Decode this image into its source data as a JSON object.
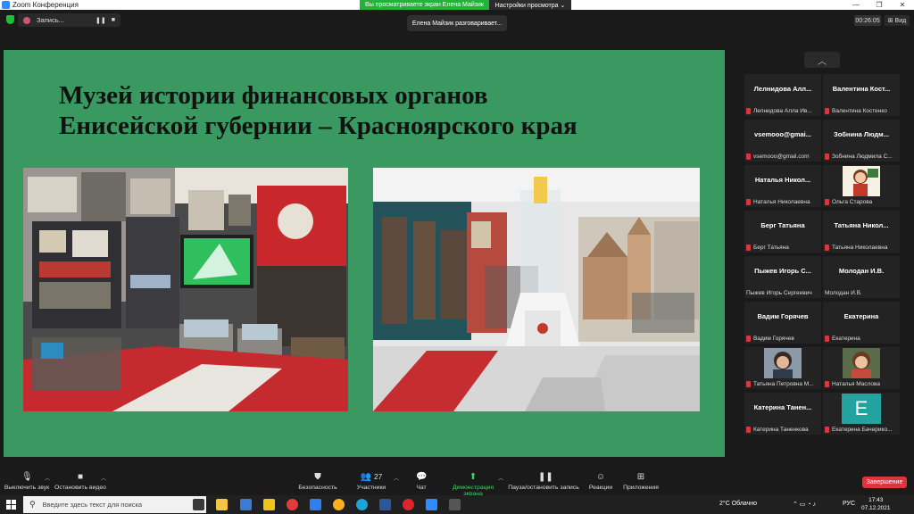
{
  "window": {
    "title": "Zoom Конференция",
    "min": "—",
    "max": "❐",
    "close": "✕"
  },
  "topbar": {
    "recording_label": "Запись...",
    "recording_ctrl": [
      "❚❚",
      "■"
    ],
    "share_banner": "Вы просматриваете экран Елена Майзик",
    "view_options": "Настройки просмотра ⌄",
    "talking_tooltip": "Елена Майзик разговаривает...",
    "timer": "00:26:05",
    "view_button": "⊞ Вид"
  },
  "slide": {
    "title_line1": "Музей истории финансовых органов",
    "title_line2": "Енисейской губернии – Красноярского края"
  },
  "panel": {
    "scroll_up": "︿",
    "participants": [
      {
        "name": "Лелнидова  Алл...",
        "footer": "Лелнидова Алла Ив...",
        "avatar": ""
      },
      {
        "name": "Валентина  Кост...",
        "footer": "Валентина Костенко",
        "avatar": ""
      },
      {
        "name": "vsemooo@gmai...",
        "footer": "vsemooo@gmail.com",
        "avatar": ""
      },
      {
        "name": "Зобнина  Людм...",
        "footer": "Зобнина Людмила С...",
        "avatar": ""
      },
      {
        "name": "Наталья  Никол...",
        "footer": "Наталья Николаевна",
        "avatar": ""
      },
      {
        "name": "",
        "footer": "Ольга Старова",
        "avatar": "teacher-cartoon"
      },
      {
        "name": "Берг Татьяна",
        "footer": "Берг Татьяна",
        "avatar": ""
      },
      {
        "name": "Татьяна  Никол...",
        "footer": "Татьяна Николаевна",
        "avatar": ""
      },
      {
        "name": "Пыжев  Игорь  С...",
        "footer": "Пыжев Игорь Сергеевич",
        "avatar": ""
      },
      {
        "name": "Молодан И.В.",
        "footer": "Молодан И.В.",
        "avatar": ""
      },
      {
        "name": "Вадим Горячев",
        "footer": "Вадим Горячев",
        "avatar": ""
      },
      {
        "name": "Екатерина",
        "footer": "Екатерина",
        "avatar": ""
      },
      {
        "name": "",
        "footer": "Татьяна Петровна М...",
        "avatar": "photo"
      },
      {
        "name": "",
        "footer": "Наталья Маслова",
        "avatar": "photo"
      },
      {
        "name": "Катерина  Танен...",
        "footer": "Катерина Таненкова",
        "avatar": ""
      },
      {
        "name": "",
        "footer": "Екатерина Бачерико...",
        "avatar": "letter",
        "letter": "E"
      }
    ]
  },
  "toolbar": {
    "mute": "Выключить звук",
    "stop_video": "Остановить видео",
    "security": "Безопасность",
    "participants": "Участники",
    "participants_count": "27",
    "chat": "Чат",
    "share": "Демонстрация экрана",
    "pause_rec": "Пауза/остановить запись",
    "reactions": "Реакции",
    "apps": "Приложения",
    "end": "Завершение",
    "caret": "︿"
  },
  "taskbar": {
    "search_placeholder": "Введите здесь текст для поиска",
    "search_glyph": "⚲",
    "weather": "2°C  Облачно",
    "tray_icons": "⌃  ▭  ◔  ♪",
    "lang": "РУС",
    "time": "17:43",
    "date": "07.12.2021"
  },
  "colors": {
    "slide_bg": "#3a9960",
    "share_green": "#23b33a",
    "end_red": "#d9363e",
    "zoom_blue": "#2d8cff"
  }
}
